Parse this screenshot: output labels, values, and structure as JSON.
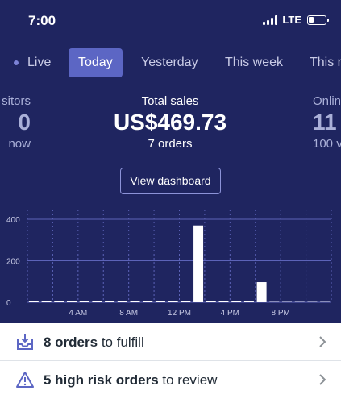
{
  "status": {
    "time": "7:00",
    "network": "LTE",
    "battery_level": 0.3
  },
  "tabs": [
    {
      "label": "Live",
      "active": false
    },
    {
      "label": "Today",
      "active": true
    },
    {
      "label": "Yesterday",
      "active": false
    },
    {
      "label": "This week",
      "active": false
    },
    {
      "label": "This m",
      "active": false
    }
  ],
  "metrics": {
    "left": {
      "label": "sitors",
      "value": "0",
      "sub": "now"
    },
    "center": {
      "label": "Total sales",
      "value": "US$469.73",
      "sub": "7 orders"
    },
    "right": {
      "label": "Onlin",
      "value": "11",
      "sub": "100 v"
    }
  },
  "dashboard_button": "View dashboard",
  "chart_data": {
    "type": "bar",
    "y_ticks": [
      "400",
      "200",
      "0"
    ],
    "ylim": [
      0,
      400
    ],
    "x_tick_labels": [
      "4 AM",
      "8 AM",
      "12 PM",
      "4 PM",
      "8 PM"
    ],
    "hours": [
      0,
      1,
      2,
      3,
      4,
      5,
      6,
      7,
      8,
      9,
      10,
      11,
      12,
      13,
      14,
      15,
      16,
      17,
      18,
      19,
      20,
      21,
      22,
      23
    ],
    "values": [
      0,
      0,
      0,
      0,
      0,
      0,
      0,
      0,
      0,
      0,
      0,
      0,
      0,
      370,
      0,
      0,
      0,
      0,
      97,
      0,
      0,
      0,
      0,
      0
    ],
    "colors": {
      "bar": "#ffffff",
      "grid": "#5c63b8",
      "axis_text": "#c9cbe6"
    }
  },
  "list": {
    "fulfill": {
      "count_text": "8 orders",
      "rest_text": " to fulfill",
      "icon": "inbox-download-icon"
    },
    "risk": {
      "count_text": "5 high risk orders",
      "rest_text": " to review",
      "icon": "warning-triangle-icon"
    }
  }
}
